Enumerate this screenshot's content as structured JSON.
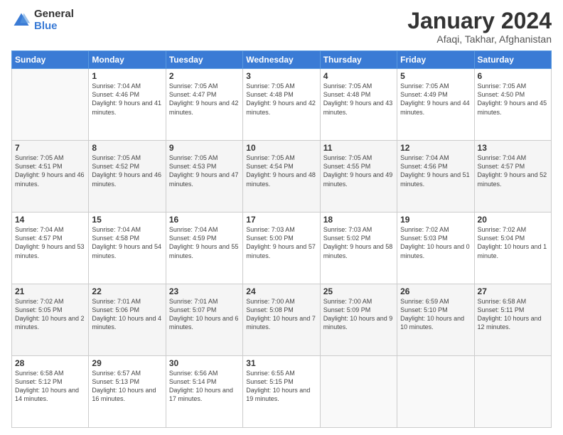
{
  "logo": {
    "general": "General",
    "blue": "Blue"
  },
  "header": {
    "title": "January 2024",
    "subtitle": "Afaqi, Takhar, Afghanistan"
  },
  "weekdays": [
    "Sunday",
    "Monday",
    "Tuesday",
    "Wednesday",
    "Thursday",
    "Friday",
    "Saturday"
  ],
  "weeks": [
    [
      {
        "day": "",
        "sunrise": "",
        "sunset": "",
        "daylight": ""
      },
      {
        "day": "1",
        "sunrise": "Sunrise: 7:04 AM",
        "sunset": "Sunset: 4:46 PM",
        "daylight": "Daylight: 9 hours and 41 minutes."
      },
      {
        "day": "2",
        "sunrise": "Sunrise: 7:05 AM",
        "sunset": "Sunset: 4:47 PM",
        "daylight": "Daylight: 9 hours and 42 minutes."
      },
      {
        "day": "3",
        "sunrise": "Sunrise: 7:05 AM",
        "sunset": "Sunset: 4:48 PM",
        "daylight": "Daylight: 9 hours and 42 minutes."
      },
      {
        "day": "4",
        "sunrise": "Sunrise: 7:05 AM",
        "sunset": "Sunset: 4:48 PM",
        "daylight": "Daylight: 9 hours and 43 minutes."
      },
      {
        "day": "5",
        "sunrise": "Sunrise: 7:05 AM",
        "sunset": "Sunset: 4:49 PM",
        "daylight": "Daylight: 9 hours and 44 minutes."
      },
      {
        "day": "6",
        "sunrise": "Sunrise: 7:05 AM",
        "sunset": "Sunset: 4:50 PM",
        "daylight": "Daylight: 9 hours and 45 minutes."
      }
    ],
    [
      {
        "day": "7",
        "sunrise": "Sunrise: 7:05 AM",
        "sunset": "Sunset: 4:51 PM",
        "daylight": "Daylight: 9 hours and 46 minutes."
      },
      {
        "day": "8",
        "sunrise": "Sunrise: 7:05 AM",
        "sunset": "Sunset: 4:52 PM",
        "daylight": "Daylight: 9 hours and 46 minutes."
      },
      {
        "day": "9",
        "sunrise": "Sunrise: 7:05 AM",
        "sunset": "Sunset: 4:53 PM",
        "daylight": "Daylight: 9 hours and 47 minutes."
      },
      {
        "day": "10",
        "sunrise": "Sunrise: 7:05 AM",
        "sunset": "Sunset: 4:54 PM",
        "daylight": "Daylight: 9 hours and 48 minutes."
      },
      {
        "day": "11",
        "sunrise": "Sunrise: 7:05 AM",
        "sunset": "Sunset: 4:55 PM",
        "daylight": "Daylight: 9 hours and 49 minutes."
      },
      {
        "day": "12",
        "sunrise": "Sunrise: 7:04 AM",
        "sunset": "Sunset: 4:56 PM",
        "daylight": "Daylight: 9 hours and 51 minutes."
      },
      {
        "day": "13",
        "sunrise": "Sunrise: 7:04 AM",
        "sunset": "Sunset: 4:57 PM",
        "daylight": "Daylight: 9 hours and 52 minutes."
      }
    ],
    [
      {
        "day": "14",
        "sunrise": "Sunrise: 7:04 AM",
        "sunset": "Sunset: 4:57 PM",
        "daylight": "Daylight: 9 hours and 53 minutes."
      },
      {
        "day": "15",
        "sunrise": "Sunrise: 7:04 AM",
        "sunset": "Sunset: 4:58 PM",
        "daylight": "Daylight: 9 hours and 54 minutes."
      },
      {
        "day": "16",
        "sunrise": "Sunrise: 7:04 AM",
        "sunset": "Sunset: 4:59 PM",
        "daylight": "Daylight: 9 hours and 55 minutes."
      },
      {
        "day": "17",
        "sunrise": "Sunrise: 7:03 AM",
        "sunset": "Sunset: 5:00 PM",
        "daylight": "Daylight: 9 hours and 57 minutes."
      },
      {
        "day": "18",
        "sunrise": "Sunrise: 7:03 AM",
        "sunset": "Sunset: 5:02 PM",
        "daylight": "Daylight: 9 hours and 58 minutes."
      },
      {
        "day": "19",
        "sunrise": "Sunrise: 7:02 AM",
        "sunset": "Sunset: 5:03 PM",
        "daylight": "Daylight: 10 hours and 0 minutes."
      },
      {
        "day": "20",
        "sunrise": "Sunrise: 7:02 AM",
        "sunset": "Sunset: 5:04 PM",
        "daylight": "Daylight: 10 hours and 1 minute."
      }
    ],
    [
      {
        "day": "21",
        "sunrise": "Sunrise: 7:02 AM",
        "sunset": "Sunset: 5:05 PM",
        "daylight": "Daylight: 10 hours and 2 minutes."
      },
      {
        "day": "22",
        "sunrise": "Sunrise: 7:01 AM",
        "sunset": "Sunset: 5:06 PM",
        "daylight": "Daylight: 10 hours and 4 minutes."
      },
      {
        "day": "23",
        "sunrise": "Sunrise: 7:01 AM",
        "sunset": "Sunset: 5:07 PM",
        "daylight": "Daylight: 10 hours and 6 minutes."
      },
      {
        "day": "24",
        "sunrise": "Sunrise: 7:00 AM",
        "sunset": "Sunset: 5:08 PM",
        "daylight": "Daylight: 10 hours and 7 minutes."
      },
      {
        "day": "25",
        "sunrise": "Sunrise: 7:00 AM",
        "sunset": "Sunset: 5:09 PM",
        "daylight": "Daylight: 10 hours and 9 minutes."
      },
      {
        "day": "26",
        "sunrise": "Sunrise: 6:59 AM",
        "sunset": "Sunset: 5:10 PM",
        "daylight": "Daylight: 10 hours and 10 minutes."
      },
      {
        "day": "27",
        "sunrise": "Sunrise: 6:58 AM",
        "sunset": "Sunset: 5:11 PM",
        "daylight": "Daylight: 10 hours and 12 minutes."
      }
    ],
    [
      {
        "day": "28",
        "sunrise": "Sunrise: 6:58 AM",
        "sunset": "Sunset: 5:12 PM",
        "daylight": "Daylight: 10 hours and 14 minutes."
      },
      {
        "day": "29",
        "sunrise": "Sunrise: 6:57 AM",
        "sunset": "Sunset: 5:13 PM",
        "daylight": "Daylight: 10 hours and 16 minutes."
      },
      {
        "day": "30",
        "sunrise": "Sunrise: 6:56 AM",
        "sunset": "Sunset: 5:14 PM",
        "daylight": "Daylight: 10 hours and 17 minutes."
      },
      {
        "day": "31",
        "sunrise": "Sunrise: 6:55 AM",
        "sunset": "Sunset: 5:15 PM",
        "daylight": "Daylight: 10 hours and 19 minutes."
      },
      {
        "day": "",
        "sunrise": "",
        "sunset": "",
        "daylight": ""
      },
      {
        "day": "",
        "sunrise": "",
        "sunset": "",
        "daylight": ""
      },
      {
        "day": "",
        "sunrise": "",
        "sunset": "",
        "daylight": ""
      }
    ]
  ]
}
